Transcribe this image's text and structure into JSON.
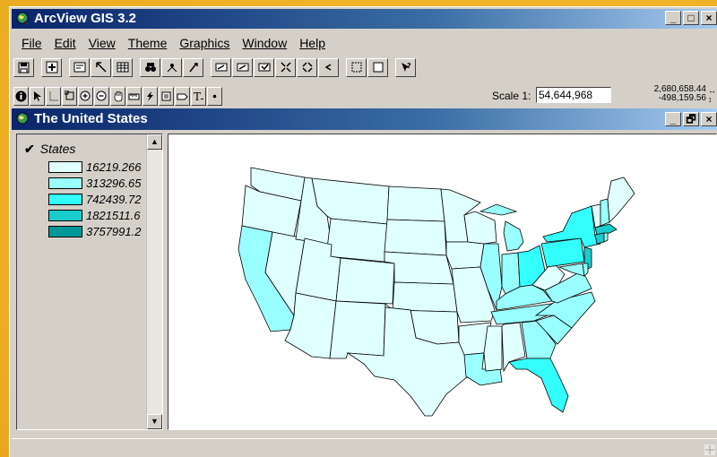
{
  "app": {
    "title": "ArcView GIS 3.2",
    "controls": [
      "_",
      "□",
      "×"
    ]
  },
  "menu": [
    {
      "label": "File"
    },
    {
      "label": "Edit"
    },
    {
      "label": "View"
    },
    {
      "label": "Theme"
    },
    {
      "label": "Graphics"
    },
    {
      "label": "Window"
    },
    {
      "label": "Help"
    }
  ],
  "toolbar": {
    "buttons": [
      "save-icon",
      "add-theme-icon",
      "theme-properties-icon",
      "edit-legend-icon",
      "open-table-icon",
      "find-icon",
      "locate-address-icon",
      "query-builder-icon",
      "zoom-full-icon",
      "zoom-to-themes-icon",
      "zoom-to-selected-icon",
      "zoom-in-fixed-icon",
      "zoom-out-fixed-icon",
      "zoom-previous-icon",
      "select-by-theme-icon",
      "clear-selection-icon",
      "help-icon"
    ]
  },
  "tools": {
    "buttons": [
      "identify-icon",
      "pointer-icon",
      "vertex-edit-icon",
      "select-feature-icon",
      "zoom-in-icon",
      "zoom-out-icon",
      "pan-icon",
      "measure-icon",
      "hotlink-icon",
      "area-of-interest-icon",
      "label-icon",
      "text-icon",
      "draw-point-icon"
    ]
  },
  "scale": {
    "label": "Scale 1:",
    "value": "54,644,968"
  },
  "coords": {
    "x": "2,680,658.44",
    "y": "-498,159.56"
  },
  "view": {
    "title": "The United States",
    "controls": [
      "_",
      "🗗",
      "×"
    ]
  },
  "legend": {
    "layer": "States",
    "checked": true,
    "classes": [
      {
        "label": "16219.266",
        "color": "#e0ffff"
      },
      {
        "label": "313296.65",
        "color": "#99ffff"
      },
      {
        "label": "742439.72",
        "color": "#33ffff"
      },
      {
        "label": "1821511.6",
        "color": "#1acccc"
      },
      {
        "label": "3757991.2",
        "color": "#009999"
      }
    ]
  }
}
